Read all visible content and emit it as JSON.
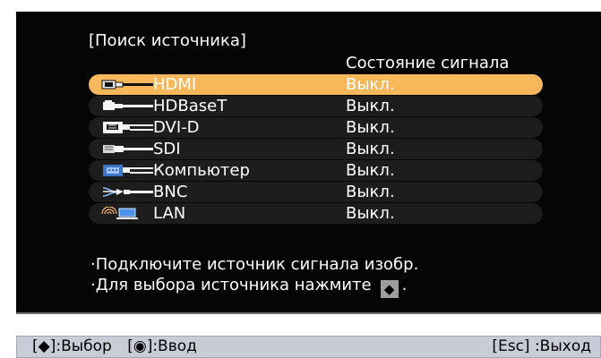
{
  "title": "[Поиск источника]",
  "column_header": "Состояние сигнала",
  "sources": [
    {
      "name": "HDMI",
      "status": "Выкл.",
      "selected": true,
      "icon": "hdmi-icon"
    },
    {
      "name": "HDBaseT",
      "status": "Выкл.",
      "selected": false,
      "icon": "hdbaset-icon"
    },
    {
      "name": "DVI-D",
      "status": "Выкл.",
      "selected": false,
      "icon": "dvi-d-icon"
    },
    {
      "name": "SDI",
      "status": "Выкл.",
      "selected": false,
      "icon": "sdi-icon"
    },
    {
      "name": "Компьютер",
      "status": "Выкл.",
      "selected": false,
      "icon": "computer-vga-icon"
    },
    {
      "name": "BNC",
      "status": "Выкл.",
      "selected": false,
      "icon": "bnc-icon"
    },
    {
      "name": "LAN",
      "status": "Выкл.",
      "selected": false,
      "icon": "lan-icon"
    }
  ],
  "instructions": {
    "line1": "·Подключите источник сигнала изобр.",
    "line2": "·Для выбора источника нажмите",
    "line2_suffix": "."
  },
  "footer": {
    "select": "[◆]:Выбор",
    "enter": "[◉]:Ввод",
    "exit": "[Esc] :Выход"
  },
  "colors": {
    "panel_background": "#050505",
    "row_background": "#1d1d1d",
    "selected_row": "#f6b85a",
    "footer_background": "#c8ccd7"
  }
}
